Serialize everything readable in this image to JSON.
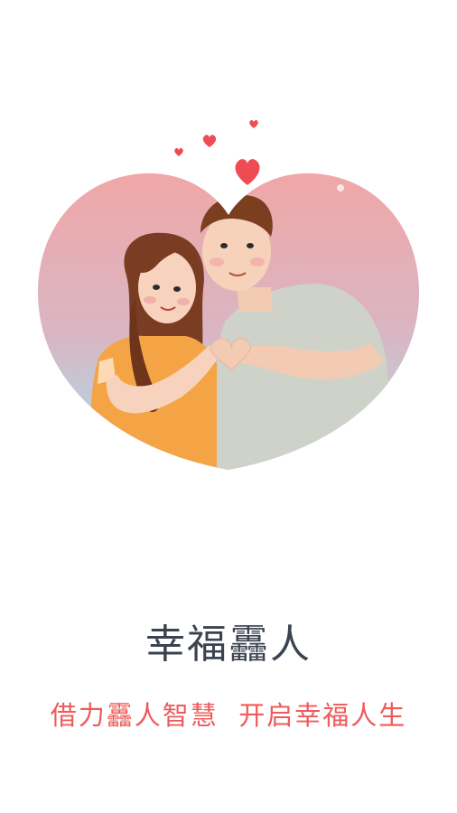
{
  "splash": {
    "title": "幸福靐人",
    "subtitle": "借力靐人智慧  开启幸福人生"
  },
  "colors": {
    "title": "#3b4250",
    "subtitle": "#ef5a5a",
    "heart_gradient_top": "#f0a7a7",
    "heart_gradient_bottom": "#a6e0ee",
    "floating_hearts": "#ef4b55"
  },
  "illustration": {
    "subject": "couple-making-heart-hands-illustration"
  }
}
